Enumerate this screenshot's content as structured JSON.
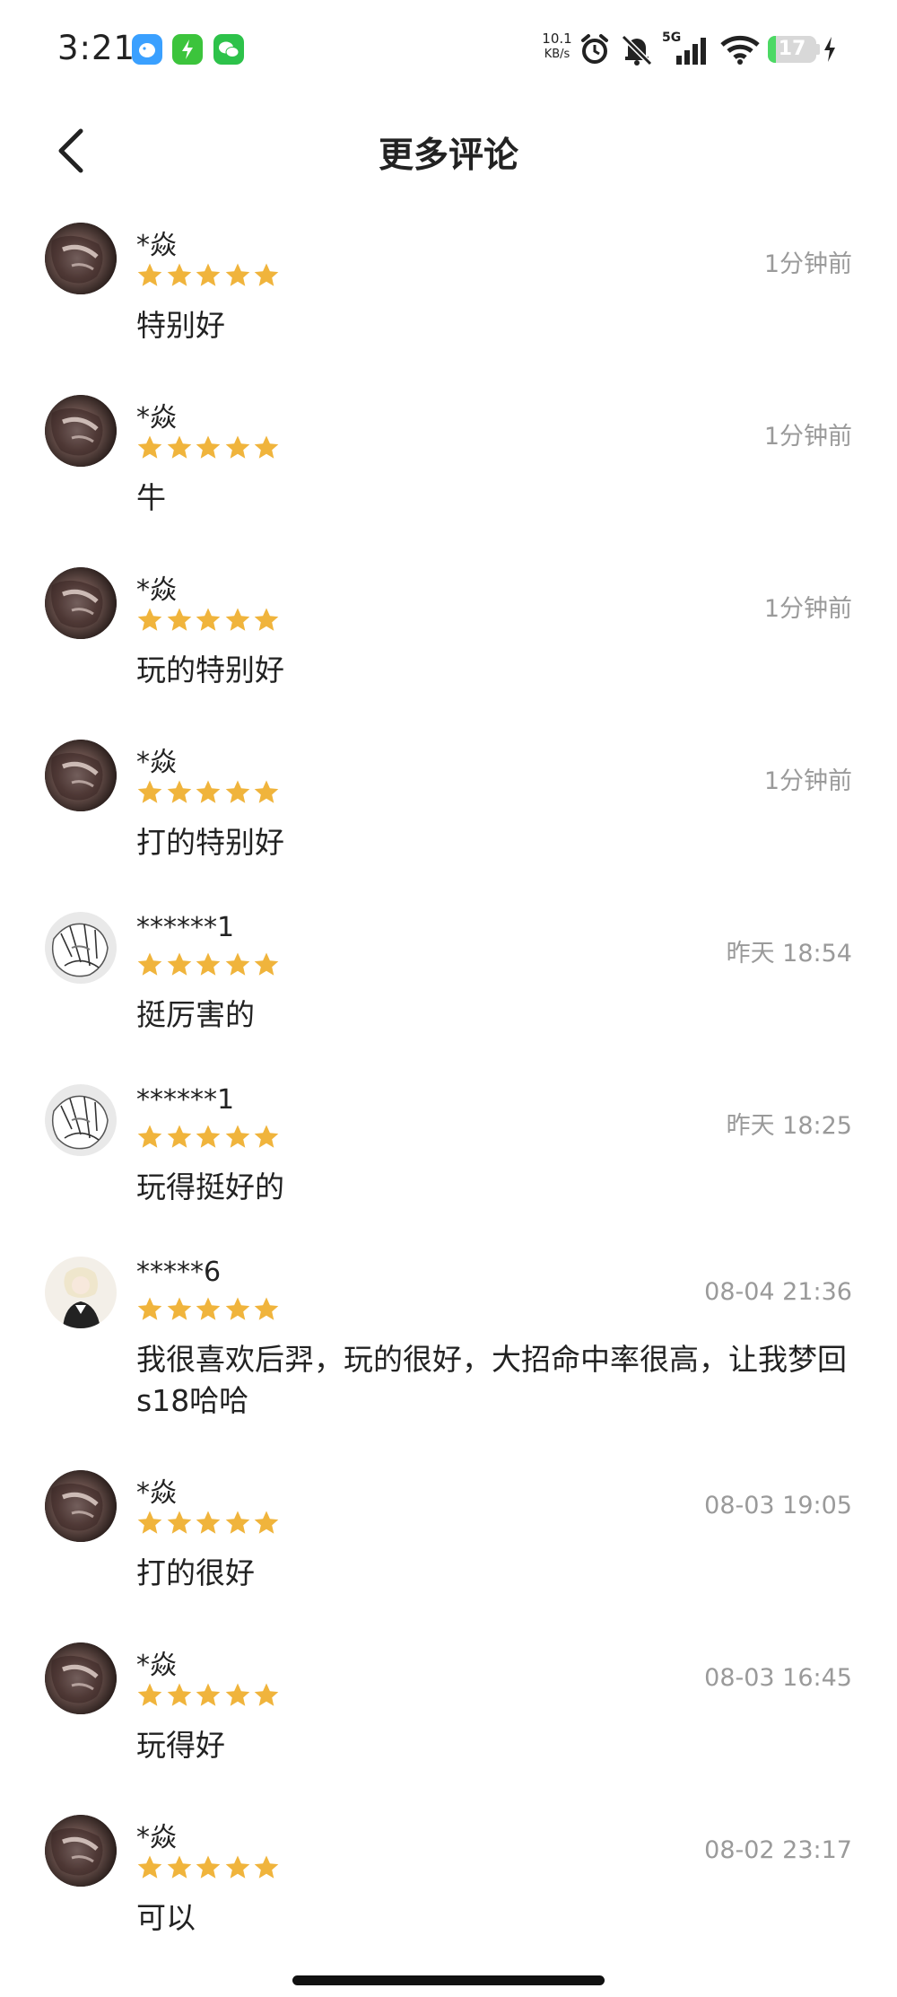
{
  "status_bar": {
    "time": "3:21",
    "apps": [
      "fish-app-icon",
      "charge-app-icon",
      "wechat-icon"
    ],
    "net_speed_value": "10.1",
    "net_speed_unit": "KB/s",
    "network": "5G",
    "battery": "17",
    "battery_level": 0.17
  },
  "header": {
    "title": "更多评论",
    "back_icon": "chevron-left-icon"
  },
  "reviews": [
    {
      "user": "*焱",
      "stars": 5,
      "time": "1分钟前",
      "text": "特别好",
      "avatar": "dark"
    },
    {
      "user": "*焱",
      "stars": 5,
      "time": "1分钟前",
      "text": "牛",
      "avatar": "dark"
    },
    {
      "user": "*焱",
      "stars": 5,
      "time": "1分钟前",
      "text": "玩的特别好",
      "avatar": "dark"
    },
    {
      "user": "*焱",
      "stars": 5,
      "time": "1分钟前",
      "text": "打的特别好",
      "avatar": "dark"
    },
    {
      "user": "******1",
      "stars": 5,
      "time": "昨天 18:54",
      "text": "挺厉害的",
      "avatar": "sketch"
    },
    {
      "user": "******1",
      "stars": 5,
      "time": "昨天 18:25",
      "text": "玩得挺好的",
      "avatar": "sketch"
    },
    {
      "user": "*****6",
      "stars": 5,
      "time": "08-04 21:36",
      "text": "我很喜欢后羿，玩的很好，大招命中率很高，让我梦回s18哈哈",
      "avatar": "anime"
    },
    {
      "user": "*焱",
      "stars": 5,
      "time": "08-03 19:05",
      "text": "打的很好",
      "avatar": "dark"
    },
    {
      "user": "*焱",
      "stars": 5,
      "time": "08-03 16:45",
      "text": "玩得好",
      "avatar": "dark"
    },
    {
      "user": "*焱",
      "stars": 5,
      "time": "08-02 23:17",
      "text": "可以",
      "avatar": "dark"
    }
  ],
  "colors": {
    "star": "#f0b43c",
    "time_text": "#9a9a9a",
    "battery_fill": "#4cd964"
  }
}
